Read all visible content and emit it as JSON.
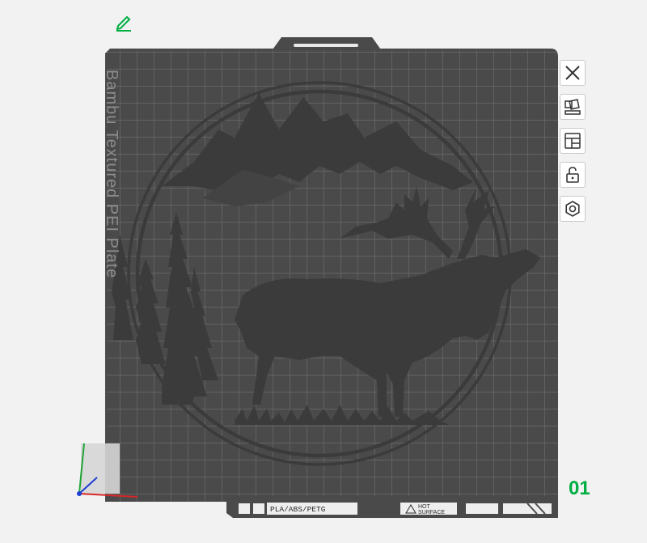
{
  "plate": {
    "label": "Bambu Textured PEI Plate",
    "number": "01",
    "strip": {
      "materials": "PLA/ABS/PETG",
      "warning_line1": "HOT",
      "warning_line2": "SURFACE"
    }
  },
  "colors": {
    "accent": "#00ae42",
    "plate": "#4a4a4a",
    "grid": "#6a6a6a",
    "model": "#3d3d3d"
  },
  "icons": {
    "edit": "pencil-icon",
    "close": "close-icon",
    "arrange": "arrange-icon",
    "layout": "layout-icon",
    "lock": "lock-icon",
    "settings": "gear-icon"
  }
}
